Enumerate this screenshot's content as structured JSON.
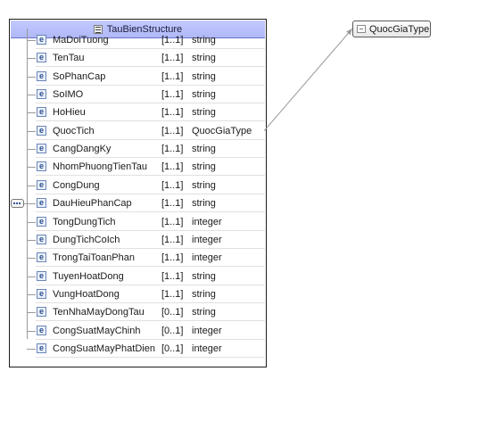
{
  "structure": {
    "title": "TauBienStructure",
    "element_icon_letter": "e",
    "elements": [
      {
        "name": "MaDoiTuong",
        "cardinality": "[1..1]",
        "type": "string"
      },
      {
        "name": "TenTau",
        "cardinality": "[1..1]",
        "type": "string"
      },
      {
        "name": "SoPhanCap",
        "cardinality": "[1..1]",
        "type": "string"
      },
      {
        "name": "SoIMO",
        "cardinality": "[1..1]",
        "type": "string"
      },
      {
        "name": "HoHieu",
        "cardinality": "[1..1]",
        "type": "string"
      },
      {
        "name": "QuocTich",
        "cardinality": "[1..1]",
        "type": "QuocGiaType"
      },
      {
        "name": "CangDangKy",
        "cardinality": "[1..1]",
        "type": "string"
      },
      {
        "name": "NhomPhuongTienTau",
        "cardinality": "[1..1]",
        "type": "string"
      },
      {
        "name": "CongDung",
        "cardinality": "[1..1]",
        "type": "string"
      },
      {
        "name": "DauHieuPhanCap",
        "cardinality": "[1..1]",
        "type": "string"
      },
      {
        "name": "TongDungTich",
        "cardinality": "[1..1]",
        "type": "integer"
      },
      {
        "name": "DungTichCoIch",
        "cardinality": "[1..1]",
        "type": "integer"
      },
      {
        "name": "TrongTaiToanPhan",
        "cardinality": "[1..1]",
        "type": "integer"
      },
      {
        "name": "TuyenHoatDong",
        "cardinality": "[1..1]",
        "type": "string"
      },
      {
        "name": "VungHoatDong",
        "cardinality": "[1..1]",
        "type": "string"
      },
      {
        "name": "TenNhaMayDongTau",
        "cardinality": "[0..1]",
        "type": "string"
      },
      {
        "name": "CongSuatMayChinh",
        "cardinality": "[0..1]",
        "type": "integer"
      },
      {
        "name": "CongSuatMayPhatDien",
        "cardinality": "[0..1]",
        "type": "integer"
      }
    ]
  },
  "referenced_type": {
    "label": "QuocGiaType",
    "linked_from": "QuocTich"
  },
  "colors": {
    "header_fill": "#b8bff9",
    "connector": "#9a9a9a",
    "element_icon": "#2d4f8f"
  }
}
